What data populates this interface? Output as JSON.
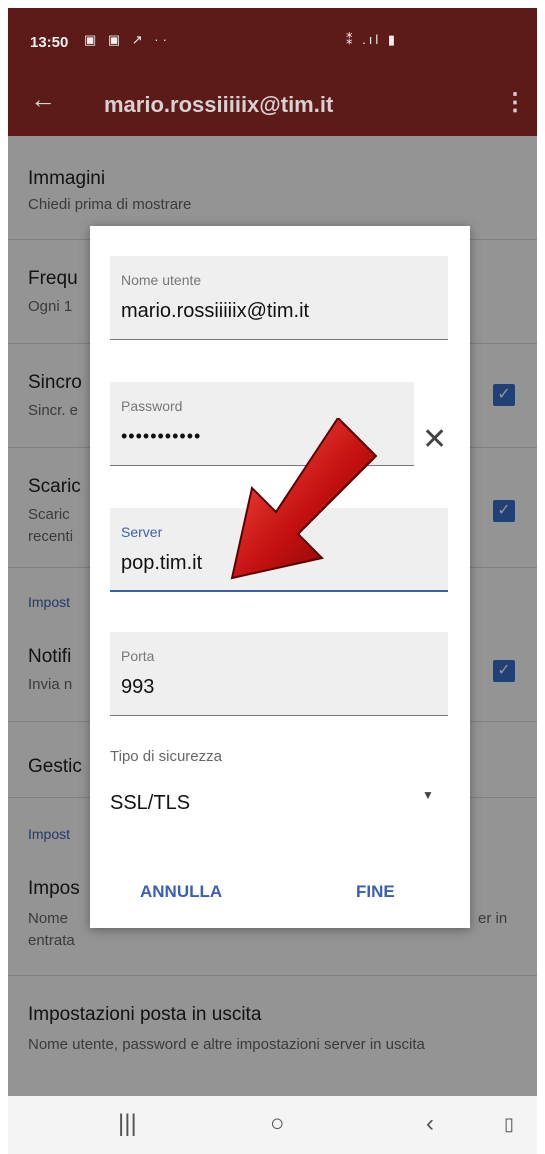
{
  "status": {
    "time": "13:50",
    "left_icons": "▣ ▣ ↗ ··",
    "right_icons": "⁑ .ıl ▮"
  },
  "toolbar": {
    "title": "mario.rossiiiiix@tim.it"
  },
  "list": {
    "images_title": "Immagini",
    "images_sub": "Chiedi prima di mostrare",
    "freq_title": "Frequ",
    "freq_sub": "Ogni 1",
    "sync_title": "Sincro",
    "sync_sub": "Sincr. e",
    "download_title": "Scaric",
    "download_sub": "Scaric recenti",
    "section1": "Impost",
    "notif_title": "Notifi",
    "notif_sub": "Invia n",
    "manage_title": "Gestic",
    "section2": "Impost",
    "incoming_title": "Impos",
    "incoming_sub_start": "Nome",
    "incoming_sub_end": "er in",
    "incoming_sub_line2": "entrata",
    "outgoing_title": "Impostazioni posta in uscita",
    "outgoing_sub": "Nome utente, password e altre impostazioni server in uscita"
  },
  "dialog": {
    "username_label": "Nome utente",
    "username_value": "mario.rossiiiiix@tim.it",
    "password_label": "Password",
    "password_value": "•••••••••••",
    "server_label": "Server",
    "server_value": "pop.tim.it",
    "port_label": "Porta",
    "port_value": "993",
    "security_label": "Tipo di sicurezza",
    "security_value": "SSL/TLS",
    "cancel_label": "ANNULLA",
    "done_label": "FINE"
  },
  "colors": {
    "toolbar": "#5c1a18",
    "accent": "#3b5fb2",
    "arrow": "#c41010"
  },
  "icons": {
    "back": "back-arrow-icon",
    "menu": "overflow-menu-icon",
    "clear": "close-icon",
    "dropdown": "dropdown-triangle-icon"
  }
}
